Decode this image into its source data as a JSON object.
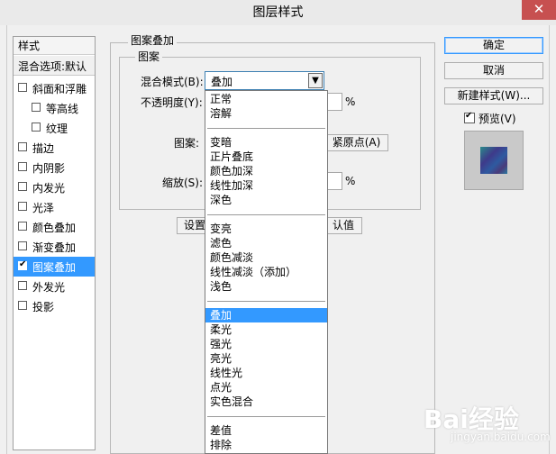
{
  "window": {
    "title": "图层样式",
    "close_glyph": "✕"
  },
  "styles_panel": {
    "header": "样式",
    "blend_options": "混合选项:默认",
    "items": [
      {
        "label": "斜面和浮雕",
        "checked": false,
        "sub": false,
        "selected": false
      },
      {
        "label": "等高线",
        "checked": false,
        "sub": true,
        "selected": false
      },
      {
        "label": "纹理",
        "checked": false,
        "sub": true,
        "selected": false
      },
      {
        "label": "描边",
        "checked": false,
        "sub": false,
        "selected": false
      },
      {
        "label": "内阴影",
        "checked": false,
        "sub": false,
        "selected": false
      },
      {
        "label": "内发光",
        "checked": false,
        "sub": false,
        "selected": false
      },
      {
        "label": "光泽",
        "checked": false,
        "sub": false,
        "selected": false
      },
      {
        "label": "颜色叠加",
        "checked": false,
        "sub": false,
        "selected": false
      },
      {
        "label": "渐变叠加",
        "checked": false,
        "sub": false,
        "selected": false
      },
      {
        "label": "图案叠加",
        "checked": true,
        "sub": false,
        "selected": true
      },
      {
        "label": "外发光",
        "checked": false,
        "sub": false,
        "selected": false
      },
      {
        "label": "投影",
        "checked": false,
        "sub": false,
        "selected": false
      }
    ]
  },
  "pattern_overlay": {
    "group_title": "图案叠加",
    "subgroup_title": "图案",
    "blend_mode_label": "混合模式(B):",
    "blend_mode_value": "叠加",
    "opacity_label": "不透明度(Y):",
    "opacity_unit": "%",
    "pattern_label": "图案:",
    "snap_origin_button": "紧原点(A)",
    "scale_label": "缩放(S):",
    "scale_unit": "%",
    "set_default_button": "设置",
    "reset_default_button": "认值"
  },
  "blend_dropdown": {
    "selected": "叠加",
    "groups": [
      [
        "正常",
        "溶解"
      ],
      [
        "变暗",
        "正片叠底",
        "颜色加深",
        "线性加深",
        "深色"
      ],
      [
        "变亮",
        "滤色",
        "颜色减淡",
        "线性减淡（添加）",
        "浅色"
      ],
      [
        "叠加",
        "柔光",
        "强光",
        "亮光",
        "线性光",
        "点光",
        "实色混合"
      ],
      [
        "差值",
        "排除"
      ]
    ]
  },
  "actions": {
    "ok": "确定",
    "cancel": "取消",
    "new_style": "新建样式(W)...",
    "preview_label": "预览(V)",
    "preview_checked": true
  },
  "watermark": {
    "text": "Bai经验",
    "sub": "jingyan.baidu.com"
  },
  "colors": {
    "selection": "#3399ff",
    "default_button_border": "#3399ff",
    "close_button": "#c75050"
  }
}
